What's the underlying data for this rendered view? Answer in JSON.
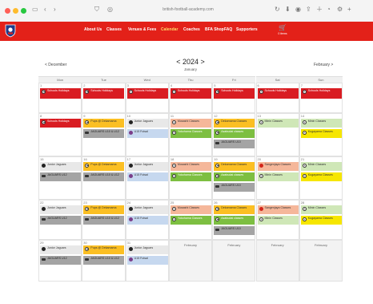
{
  "browser": {
    "url": "british-football-academy.com",
    "icons": [
      "sidebar-icon",
      "back-icon",
      "forward-icon",
      "shield-icon",
      "translate-icon",
      "refresh-icon",
      "download-icon",
      "extension-icon",
      "share-icon",
      "add-tab-icon",
      "tabs-icon",
      "settings-icon",
      "new-tab-icon"
    ]
  },
  "nav": {
    "items": [
      "About Us",
      "Classes",
      "Venues & Fees",
      "Calendar",
      "Coaches",
      "BFA Shop",
      "FAQ",
      "Supporters"
    ],
    "cart_label": "0 items"
  },
  "calendar": {
    "prev": "< December",
    "next": "February >",
    "year": "< 2024 >",
    "month": "January",
    "days": [
      "Mon",
      "Tue",
      "Wed",
      "Thu",
      "Fri",
      "Sat",
      "Sun"
    ],
    "weeks": [
      [
        {
          "num": "1",
          "events": [
            {
              "t": "Schools Holidays",
              "c": "red",
              "i": "ball"
            }
          ]
        },
        {
          "num": "2",
          "events": [
            {
              "t": "Schools Holidays",
              "c": "red",
              "i": "ball"
            }
          ]
        },
        {
          "num": "3",
          "events": [
            {
              "t": "Schools Holidays",
              "c": "red",
              "i": "ball"
            }
          ]
        },
        {
          "num": "4",
          "events": [
            {
              "t": "Schools Holidays",
              "c": "red",
              "i": "ball"
            }
          ]
        },
        {
          "num": "5",
          "events": [
            {
              "t": "Schools Holidays",
              "c": "red",
              "i": "ball"
            }
          ]
        },
        {
          "num": "6",
          "events": [
            {
              "t": "Schools Holidays",
              "c": "red",
              "i": "ball"
            }
          ]
        },
        {
          "num": "7",
          "events": [
            {
              "t": "Schools Holidays",
              "c": "red",
              "i": "ball"
            }
          ]
        }
      ],
      [
        {
          "num": "8",
          "events": [
            {
              "t": "Schools Holidays",
              "c": "red",
              "i": "ball"
            }
          ]
        },
        {
          "num": "9",
          "events": [
            {
              "t": "Pups @ Dekamama",
              "c": "orange",
              "i": "ball"
            },
            {
              "t": "JAGUARS U10 & U12",
              "c": "dgrey",
              "i": "car"
            }
          ]
        },
        {
          "num": "10",
          "events": [
            {
              "t": "Junior Jaguars",
              "c": "lgrey",
              "i": "blk"
            },
            {
              "t": "U15 Futsal",
              "c": "lblue",
              "i": "pup"
            }
          ]
        },
        {
          "num": "11",
          "events": [
            {
              "t": "Musashi Classes",
              "c": "salmon",
              "i": "ball"
            },
            {
              "t": "Yokohama Classes",
              "c": "green",
              "i": "ball"
            }
          ]
        },
        {
          "num": "12",
          "events": [
            {
              "t": "Dekamama Classes",
              "c": "orange",
              "i": "ball"
            },
            {
              "t": "Azabudai classes",
              "c": "green",
              "i": "ball"
            },
            {
              "t": "JAGUARS U10",
              "c": "dgrey",
              "i": "car"
            }
          ]
        },
        {
          "num": "13",
          "events": [
            {
              "t": "Minin Classes",
              "c": "lgreen",
              "i": "ball"
            }
          ]
        },
        {
          "num": "14",
          "events": [
            {
              "t": "Minin Classes",
              "c": "lgreen",
              "i": "ball"
            },
            {
              "t": "Kugayama Classes",
              "c": "yellow",
              "i": "ball"
            }
          ]
        }
      ],
      [
        {
          "num": "15",
          "events": [
            {
              "t": "Junior Jaguars",
              "c": "lgrey",
              "i": "blk"
            },
            {
              "t": "JAGUARS U12",
              "c": "dgrey",
              "i": "car"
            }
          ]
        },
        {
          "num": "16",
          "events": [
            {
              "t": "Pups @ Dekamama",
              "c": "orange",
              "i": "ball"
            },
            {
              "t": "JAGUARS U10 & U12",
              "c": "dgrey",
              "i": "car"
            }
          ]
        },
        {
          "num": "17",
          "events": [
            {
              "t": "Junior Jaguars",
              "c": "lgrey",
              "i": "blk"
            },
            {
              "t": "U15 Futsal",
              "c": "lblue",
              "i": "pup"
            }
          ]
        },
        {
          "num": "18",
          "events": [
            {
              "t": "Musashi Classes",
              "c": "salmon",
              "i": "ball"
            },
            {
              "t": "Yokohama Classes",
              "c": "green",
              "i": "ball"
            }
          ]
        },
        {
          "num": "19",
          "events": [
            {
              "t": "Dekamama Classes",
              "c": "orange",
              "i": "ball"
            },
            {
              "t": "Azabudai classes",
              "c": "green",
              "i": "ball"
            },
            {
              "t": "JAGUARS U10",
              "c": "dgrey",
              "i": "car"
            }
          ]
        },
        {
          "num": "20",
          "events": [
            {
              "t": "Sangenjaya Classes",
              "c": "salmon",
              "i": "redc"
            },
            {
              "t": "Minin Classes",
              "c": "lgreen",
              "i": "ball"
            }
          ]
        },
        {
          "num": "21",
          "events": [
            {
              "t": "Minin Classes",
              "c": "lgreen",
              "i": "ball"
            },
            {
              "t": "Kugayama Classes",
              "c": "yellow",
              "i": "ball"
            }
          ]
        }
      ],
      [
        {
          "num": "22",
          "events": [
            {
              "t": "Junior Jaguars",
              "c": "lgrey",
              "i": "blk"
            },
            {
              "t": "JAGUARS U12",
              "c": "dgrey",
              "i": "car"
            }
          ]
        },
        {
          "num": "23",
          "events": [
            {
              "t": "Pups @ Dekamama",
              "c": "orange",
              "i": "ball"
            },
            {
              "t": "JAGUARS U10 & U12",
              "c": "dgrey",
              "i": "car"
            }
          ]
        },
        {
          "num": "24",
          "events": [
            {
              "t": "Junior Jaguars",
              "c": "lgrey",
              "i": "blk"
            },
            {
              "t": "U15 Futsal",
              "c": "lblue",
              "i": "pup"
            }
          ]
        },
        {
          "num": "25",
          "events": [
            {
              "t": "Musashi Classes",
              "c": "salmon",
              "i": "ball"
            },
            {
              "t": "Yokohama Classes",
              "c": "green",
              "i": "ball"
            }
          ]
        },
        {
          "num": "26",
          "events": [
            {
              "t": "Dekamama Classes",
              "c": "orange",
              "i": "ball"
            },
            {
              "t": "Azabudai classes",
              "c": "green",
              "i": "ball"
            },
            {
              "t": "JAGUARS U10",
              "c": "dgrey",
              "i": "car"
            }
          ]
        },
        {
          "num": "27",
          "events": [
            {
              "t": "Sangenjaya Classes",
              "c": "salmon",
              "i": "redc"
            },
            {
              "t": "Minin Classes",
              "c": "lgreen",
              "i": "ball"
            }
          ]
        },
        {
          "num": "28",
          "events": [
            {
              "t": "Minin Classes",
              "c": "lgreen",
              "i": "ball"
            },
            {
              "t": "Kugayama Classes",
              "c": "yellow",
              "i": "ball"
            }
          ]
        }
      ],
      [
        {
          "num": "29",
          "events": [
            {
              "t": "Junior Jaguars",
              "c": "lgrey",
              "i": "blk"
            },
            {
              "t": "JAGUARS U12",
              "c": "dgrey",
              "i": "car"
            }
          ]
        },
        {
          "num": "30",
          "events": [
            {
              "t": "Pups @ Dekamama",
              "c": "orange",
              "i": "ball"
            },
            {
              "t": "JAGUARS U10 & U12",
              "c": "dgrey",
              "i": "car"
            }
          ]
        },
        {
          "num": "31",
          "events": [
            {
              "t": "Junior Jaguars",
              "c": "lgrey",
              "i": "blk"
            },
            {
              "t": "U15 Futsal",
              "c": "lblue",
              "i": "pup"
            }
          ]
        },
        {
          "num": "",
          "next_month": "February",
          "events": []
        },
        {
          "num": "",
          "next_month": "February",
          "events": []
        },
        {
          "num": "",
          "next_month": "February",
          "events": []
        },
        {
          "num": "",
          "next_month": "February",
          "events": []
        }
      ]
    ]
  }
}
